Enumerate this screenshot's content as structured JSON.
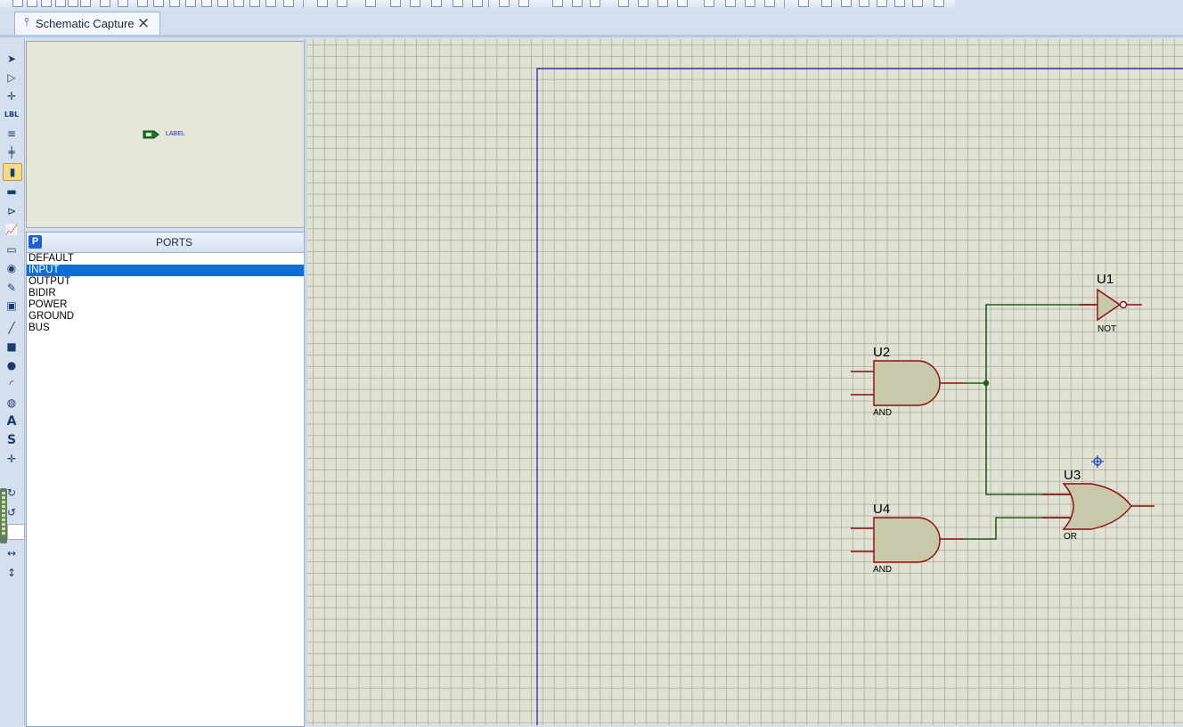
{
  "tab": {
    "title": "Schematic Capture",
    "close_glyph": "×"
  },
  "overview": {
    "preview_label": "LABEL"
  },
  "ports_panel": {
    "badge": "P",
    "title": "PORTS",
    "items": [
      {
        "label": "DEFAULT",
        "selected": false
      },
      {
        "label": "INPUT",
        "selected": true
      },
      {
        "label": "OUTPUT",
        "selected": false
      },
      {
        "label": "BIDIR",
        "selected": false
      },
      {
        "label": "POWER",
        "selected": false
      },
      {
        "label": "GROUND",
        "selected": false
      },
      {
        "label": "BUS",
        "selected": false
      }
    ]
  },
  "tools": [
    {
      "icon": "selection-mode-icon",
      "glyph": "➤"
    },
    {
      "icon": "component-mode-icon",
      "glyph": "▷"
    },
    {
      "icon": "junction-dot-icon",
      "glyph": "✛"
    },
    {
      "icon": "wire-label-icon",
      "glyph": "LBL"
    },
    {
      "icon": "text-script-icon",
      "glyph": "≡"
    },
    {
      "icon": "buses-icon",
      "glyph": "╪"
    },
    {
      "icon": "subcircuit-icon",
      "glyph": "▮",
      "selected": true
    },
    {
      "icon": "terminals-icon",
      "glyph": "▬"
    },
    {
      "icon": "device-pins-icon",
      "glyph": "⊳"
    },
    {
      "icon": "graph-mode-icon",
      "glyph": "📈"
    },
    {
      "icon": "tape-recorder-icon",
      "glyph": "▭"
    },
    {
      "icon": "generator-icon",
      "glyph": "◉"
    },
    {
      "icon": "voltage-probe-icon",
      "glyph": "✎"
    },
    {
      "icon": "virtual-instruments-icon",
      "glyph": "▣"
    },
    {
      "icon": "2d-line-icon",
      "glyph": "╱"
    },
    {
      "icon": "2d-box-icon",
      "glyph": "■"
    },
    {
      "icon": "2d-circle-icon",
      "glyph": "●"
    },
    {
      "icon": "2d-arc-icon",
      "glyph": "◜"
    },
    {
      "icon": "2d-path-icon",
      "glyph": "◍"
    },
    {
      "icon": "2d-text-icon",
      "glyph": "A"
    },
    {
      "icon": "2d-symbol-icon",
      "glyph": "S"
    },
    {
      "icon": "2d-marker-icon",
      "glyph": "✛"
    },
    {
      "icon": "rotate-clockwise-icon",
      "glyph": "↻"
    },
    {
      "icon": "rotate-anticlockwise-icon",
      "glyph": "↺"
    },
    {
      "icon": "x-mirror-icon",
      "glyph": "↔"
    },
    {
      "icon": "y-mirror-icon",
      "glyph": "↕"
    }
  ],
  "schematic": {
    "components": [
      {
        "ref": "U1",
        "type": "NOT"
      },
      {
        "ref": "U2",
        "type": "AND"
      },
      {
        "ref": "U3",
        "type": "OR"
      },
      {
        "ref": "U4",
        "type": "AND"
      }
    ],
    "colors": {
      "canvas": "#e1e1d4",
      "sheet_border": "#1a1aa8",
      "gate_body": "#c8c8aa",
      "gate_stroke": "#8b0c0c",
      "wire": "#1f5c1f",
      "marker": "#1f3fbf"
    }
  }
}
